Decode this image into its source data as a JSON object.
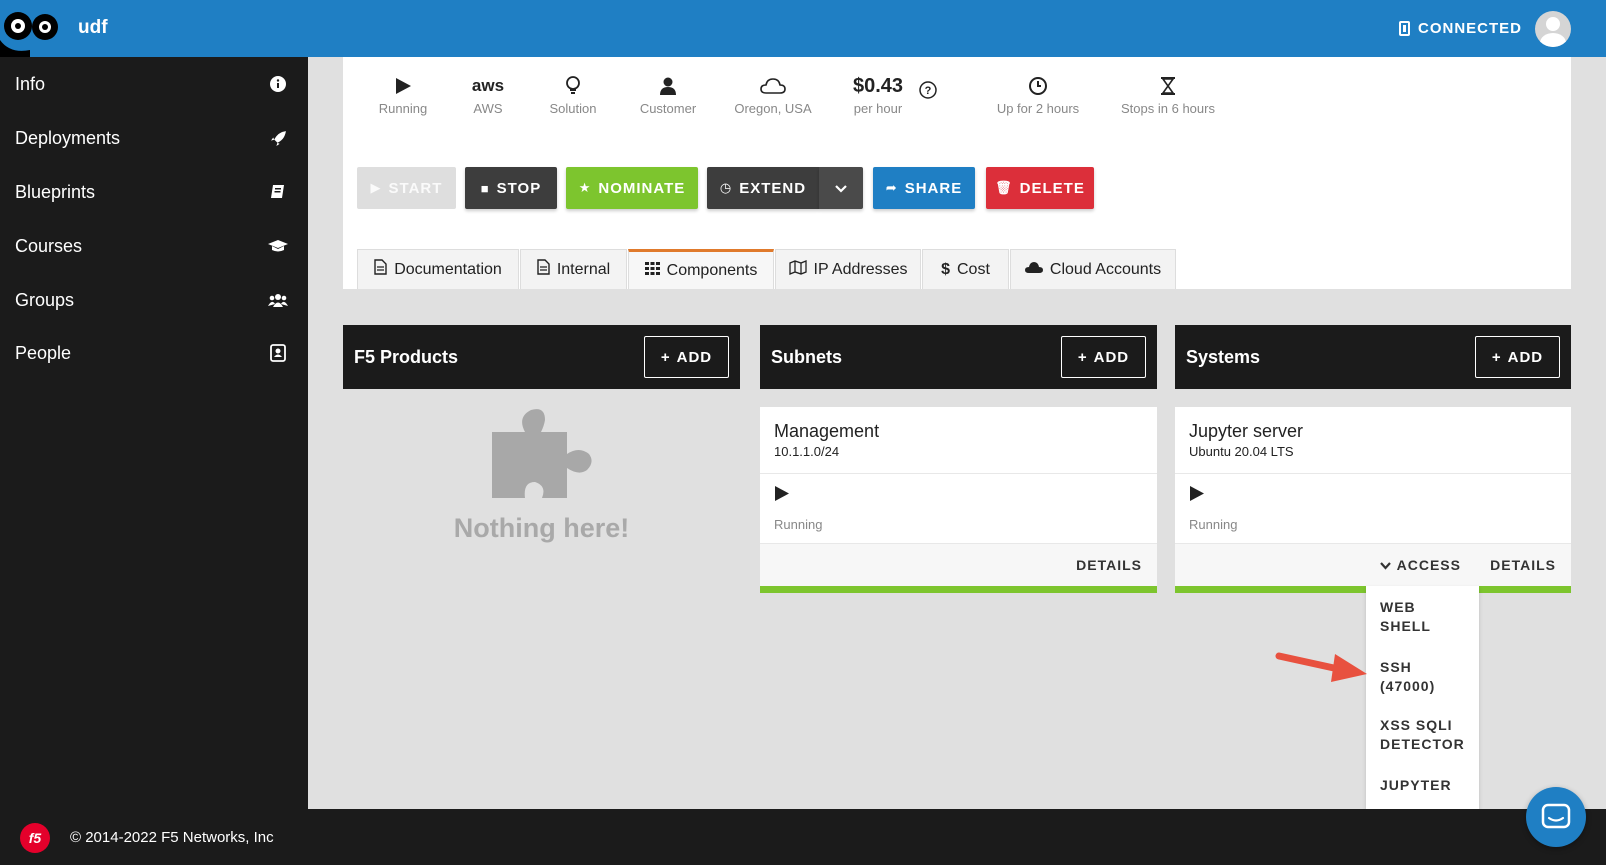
{
  "header": {
    "app_name": "udf",
    "connection_status": "CONNECTED"
  },
  "sidebar": {
    "items": [
      {
        "label": "Info",
        "icon": "info-icon"
      },
      {
        "label": "Deployments",
        "icon": "rocket-icon"
      },
      {
        "label": "Blueprints",
        "icon": "book-icon"
      },
      {
        "label": "Courses",
        "icon": "graduation-cap-icon"
      },
      {
        "label": "Groups",
        "icon": "users-icon"
      },
      {
        "label": "People",
        "icon": "address-book-icon"
      }
    ]
  },
  "status_bar": {
    "state": "Running",
    "cloud": "AWS",
    "cloud_logo": "aws",
    "type": "Solution",
    "owner": "Customer",
    "region": "Oregon, USA",
    "price": "$0.43",
    "price_unit": "per hour",
    "uptime": "Up for 2 hours",
    "stops": "Stops in 6 hours"
  },
  "actions": {
    "start": "START",
    "stop": "STOP",
    "nominate": "NOMINATE",
    "extend": "EXTEND",
    "share": "SHARE",
    "delete": "DELETE"
  },
  "tabs": [
    {
      "label": "Documentation",
      "icon": "document-icon"
    },
    {
      "label": "Internal",
      "icon": "document-icon"
    },
    {
      "label": "Components",
      "icon": "grid-icon",
      "active": true
    },
    {
      "label": "IP Addresses",
      "icon": "map-icon"
    },
    {
      "label": "Cost",
      "icon": "dollar-icon"
    },
    {
      "label": "Cloud Accounts",
      "icon": "cloud-icon"
    }
  ],
  "columns": {
    "f5_products": {
      "title": "F5 Products",
      "add_label": "ADD",
      "empty_text": "Nothing here!"
    },
    "subnets": {
      "title": "Subnets",
      "add_label": "ADD",
      "card": {
        "name": "Management",
        "detail": "10.1.1.0/24",
        "status": "Running",
        "details_label": "DETAILS"
      }
    },
    "systems": {
      "title": "Systems",
      "add_label": "ADD",
      "card": {
        "name": "Jupyter server",
        "detail": "Ubuntu 20.04 LTS",
        "status": "Running",
        "access_label": "ACCESS",
        "details_label": "DETAILS"
      }
    }
  },
  "access_menu": {
    "items": [
      {
        "line1": "WEB",
        "line2": "SHELL"
      },
      {
        "line1": "SSH",
        "line2": "(47000)"
      },
      {
        "line1": "XSS SQLI",
        "line2": "DETECTOR"
      },
      {
        "line1": "JUPYTER",
        "line2": ""
      }
    ]
  },
  "colors": {
    "brand_blue": "#1f7fc4",
    "nominate_green": "#7dc52e",
    "share_blue": "#1f7fc4",
    "delete_red": "#dc2f3a",
    "dark": "#1b1b1b",
    "arrow_red": "#e8513f"
  },
  "footer": {
    "logo_text": "f5",
    "copyright": "© 2014-2022 F5 Networks, Inc"
  }
}
